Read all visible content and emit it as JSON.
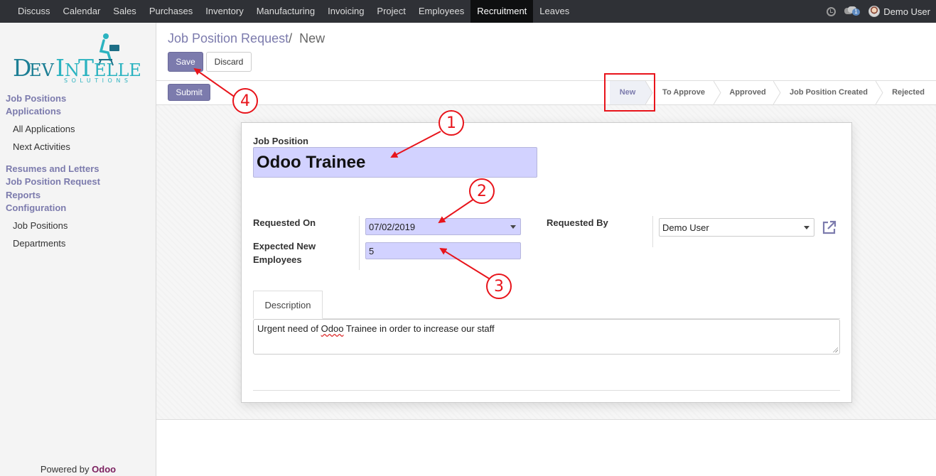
{
  "topbar": {
    "menu": [
      {
        "label": "Discuss",
        "active": false
      },
      {
        "label": "Calendar",
        "active": false
      },
      {
        "label": "Sales",
        "active": false
      },
      {
        "label": "Purchases",
        "active": false
      },
      {
        "label": "Inventory",
        "active": false
      },
      {
        "label": "Manufacturing",
        "active": false
      },
      {
        "label": "Invoicing",
        "active": false
      },
      {
        "label": "Project",
        "active": false
      },
      {
        "label": "Employees",
        "active": false
      },
      {
        "label": "Recruitment",
        "active": true
      },
      {
        "label": "Leaves",
        "active": false
      }
    ],
    "chat_badge": "1",
    "user_name": "Demo User"
  },
  "logo": {
    "text": "DevIntelle",
    "subtitle": "SOLUTIONS"
  },
  "sidebar": {
    "job_positions": "Job Positions",
    "applications": "Applications",
    "all_applications": "All Applications",
    "next_activities": "Next Activities",
    "resumes": "Resumes and Letters",
    "job_position_request": "Job Position Request",
    "reports": "Reports",
    "configuration": "Configuration",
    "config_job_positions": "Job Positions",
    "departments": "Departments",
    "powered_by": "Powered by",
    "powered_brand": "Odoo"
  },
  "control_panel": {
    "breadcrumb_parent": "Job Position Request",
    "breadcrumb_sep": "/",
    "breadcrumb_current": "New",
    "save_label": "Save",
    "discard_label": "Discard"
  },
  "statusbar": {
    "submit_label": "Submit",
    "stages": [
      "New",
      "To Approve",
      "Approved",
      "Job Position Created",
      "Rejected"
    ],
    "active_stage": "New"
  },
  "form": {
    "job_position_label": "Job Position",
    "job_position_value": "Odoo Trainee",
    "requested_on_label": "Requested On",
    "requested_on_value": "07/02/2019",
    "expected_label_line1": "Expected New",
    "expected_label_line2": "Employees",
    "expected_value": "5",
    "requested_by_label": "Requested By",
    "requested_by_value": "Demo User",
    "tab_description": "Description",
    "description_before": "Urgent need of ",
    "description_word": "Odoo",
    "description_after": " Trainee in order to increase our staff"
  },
  "annotations": {
    "n1": "1",
    "n2": "2",
    "n3": "3",
    "n4": "4"
  },
  "colors": {
    "accent": "#7c7bad",
    "topbar": "#2f3136",
    "field_bg": "#d2d2ff",
    "annotation": "#e8141b"
  }
}
